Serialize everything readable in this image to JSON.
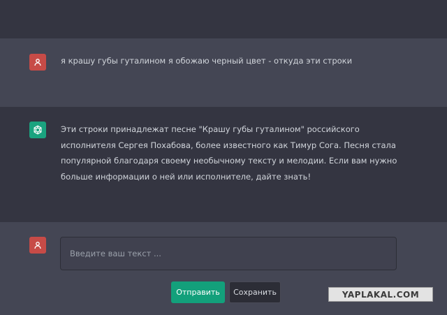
{
  "conversation": {
    "user_message": "я крашу губы гуталином я обожаю черный цвет - откуда эти строки",
    "assistant_message_lines": [
      "Эти строки принадлежат песне \"Крашу губы гуталином\" российского",
      "исполнителя Сергея Похабова, более известного как Тимур Сога. Песня стала",
      "популярной благодаря своему необычному тексту и мелодии. Если вам нужно",
      "больше информации о ней или исполнителе, дайте знать!"
    ]
  },
  "composer": {
    "placeholder": "Введите ваш текст ...",
    "value": "",
    "send_label": "Отправить",
    "save_label": "Сохранить"
  },
  "watermark": {
    "text": "YAPLAKAL.COM"
  },
  "icons": {
    "user_avatar": "user-icon",
    "assistant_avatar": "openai-logo-icon"
  },
  "colors": {
    "background": "#343541",
    "message_band": "#444654",
    "user_avatar": "#c74b47",
    "assistant_avatar": "#1aa37f",
    "send_button": "#13a07b"
  }
}
